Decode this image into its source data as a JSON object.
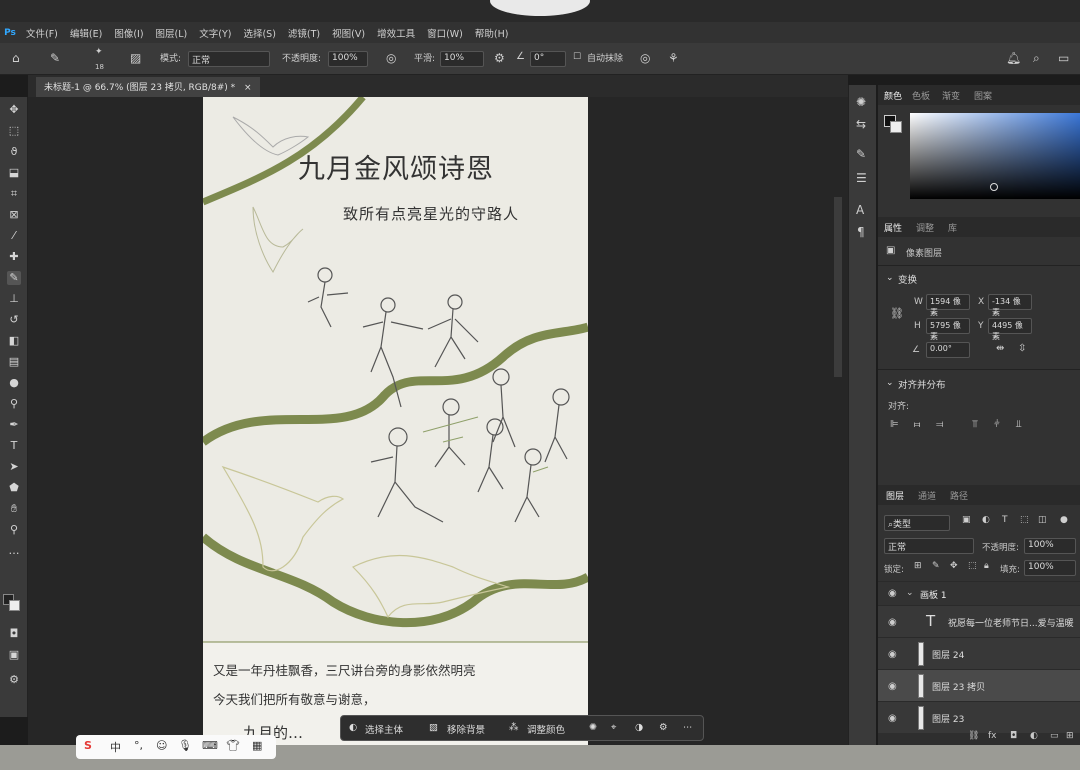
{
  "app": {
    "logo": "Ps",
    "menu": [
      "文件(F)",
      "编辑(E)",
      "图像(I)",
      "图层(L)",
      "文字(Y)",
      "选择(S)",
      "滤镜(T)",
      "视图(V)",
      "增效工具",
      "窗口(W)",
      "帮助(H)"
    ]
  },
  "options": {
    "brush_size": "18",
    "mode_label": "模式:",
    "mode_value": "正常",
    "opacity_label": "不透明度:",
    "opacity_value": "100%",
    "smooth_label": "平滑:",
    "smooth_value": "10%",
    "angle_value": "0°",
    "auto_erase_label": "自动抹除"
  },
  "document": {
    "tab_title": "未标题-1 @ 66.7% (图层 23 拷贝, RGB/8#) *"
  },
  "canvas": {
    "title": "九月金风颂诗恩",
    "subtitle": "致所有点亮星光的守路人",
    "body_line1": "又是一年丹桂飘香，三尺讲台旁的身影依然明亮",
    "body_line2": "今天我们把所有敬意与谢意，",
    "body_line3": "九月的…"
  },
  "panels": {
    "color_tabs": [
      "颜色",
      "色板",
      "渐变",
      "图案"
    ],
    "props_tabs": [
      "属性",
      "调整",
      "库"
    ],
    "pixel_layer_label": "像素图层",
    "transform_label": "变换",
    "w_label": "W",
    "w_value": "1594 像素",
    "x_label": "X",
    "x_value": "-134 像素",
    "h_label": "H",
    "h_value": "5795 像素",
    "y_label": "Y",
    "y_value": "4495 像素",
    "angle_value": "0.00°",
    "align_label": "对齐并分布",
    "align_sub": "对齐:",
    "layer_tabs": [
      "图层",
      "通道",
      "路径"
    ],
    "filter_kind": "类型",
    "blend_mode": "正常",
    "opacity_label": "不透明度:",
    "opacity_value": "100%",
    "lock_label": "锁定:",
    "fill_label": "填充:",
    "fill_value": "100%",
    "artboard_name": "画板 1",
    "layers": [
      {
        "name": "祝愿每一位老师节日...爱与温暖",
        "type": "text"
      },
      {
        "name": "图层 24",
        "type": "pixel"
      },
      {
        "name": "图层 23 拷贝",
        "type": "pixel",
        "selected": true
      },
      {
        "name": "图层 23",
        "type": "pixel"
      }
    ]
  },
  "context_bar": {
    "select_subject": "选择主体",
    "remove_bg": "移除背景",
    "adjust_color": "调整颜色"
  },
  "ime": {
    "lang": "中"
  },
  "colors": {
    "accent": "#31a8ff",
    "olive_band": "#7d8a4e"
  }
}
